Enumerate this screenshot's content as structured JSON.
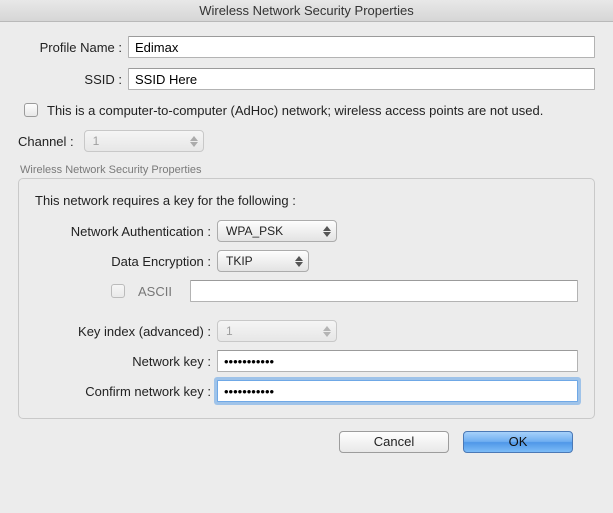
{
  "window_title": "Wireless Network Security Properties",
  "profile": {
    "name_label": "Profile Name :",
    "name_value": "Edimax",
    "ssid_label": "SSID :",
    "ssid_value": "SSID Here"
  },
  "adhoc": {
    "label": "This is a computer-to-computer (AdHoc) network; wireless access points are not used.",
    "checked": false
  },
  "channel": {
    "label": "Channel :",
    "value": "1"
  },
  "group": {
    "legend": "Wireless Network Security Properties",
    "note": "This network requires a key for the following :",
    "auth_label": "Network Authentication :",
    "auth_value": "WPA_PSK",
    "enc_label": "Data Encryption :",
    "enc_value": "TKIP",
    "ascii_label": "ASCII",
    "ascii_value": "",
    "keyindex_label": "Key index (advanced) :",
    "keyindex_value": "1",
    "netkey_label": "Network key :",
    "netkey_value": "•••••••••••",
    "confirm_label": "Confirm network key :",
    "confirm_value": "•••••••••••"
  },
  "buttons": {
    "cancel": "Cancel",
    "ok": "OK"
  }
}
